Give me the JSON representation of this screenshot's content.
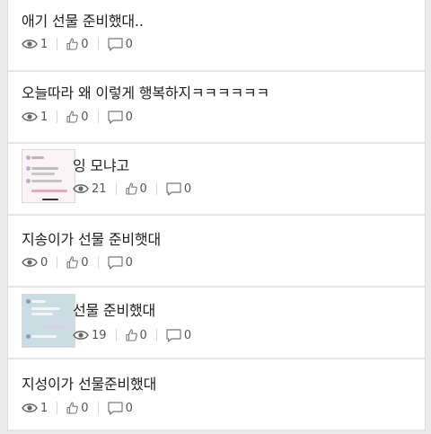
{
  "posts": [
    {
      "title": "애기 선물 준비했대..",
      "views": "1",
      "likes": "0",
      "comments": "0"
    },
    {
      "title": "오늘따라 왜 이렇게 행복하지ㅋㅋㅋㅋㅋㅋ",
      "views": "1",
      "likes": "0",
      "comments": "0"
    },
    {
      "title": "잉 모냐고",
      "views": "21",
      "likes": "0",
      "comments": "0"
    },
    {
      "title": "지송이가 선물 준비햇대",
      "views": "0",
      "likes": "0",
      "comments": "0"
    },
    {
      "title": "선물 준비했대",
      "views": "19",
      "likes": "0",
      "comments": "0"
    },
    {
      "title": "지성이가 선물준비했대",
      "views": "1",
      "likes": "0",
      "comments": "0"
    }
  ],
  "icons": {
    "views": "eye-icon",
    "likes": "thumbs-up-icon",
    "comments": "comment-icon"
  },
  "colors": {
    "background": "#ececec",
    "card": "#ffffff",
    "text": "#1f1f1f",
    "meta": "#555555"
  }
}
